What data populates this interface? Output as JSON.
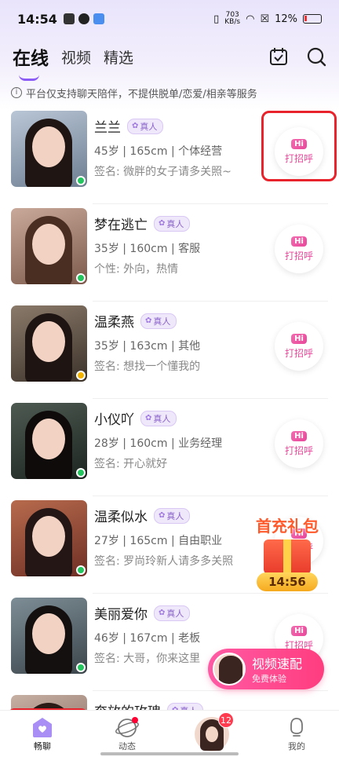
{
  "status_bar": {
    "time": "14:54",
    "net_speed": "703",
    "net_unit": "KB/s",
    "battery": "12%"
  },
  "header": {
    "tabs": [
      {
        "label": "在线",
        "active": true
      },
      {
        "label": "视频",
        "active": false
      },
      {
        "label": "精选",
        "active": false
      }
    ],
    "icons": [
      "calendar-check-icon",
      "search-icon"
    ]
  },
  "notice": "平台仅支持聊天陪伴，不提供脱单/恋爱/相亲等服务",
  "badge_label": "真人",
  "greet": {
    "hi": "Hi",
    "label": "打招呼"
  },
  "users": [
    {
      "name": "兰兰",
      "info": "45岁 | 165cm | 个体经营",
      "sign": "签名: 微胖的女子请多关照~",
      "online_color": "#22c55e"
    },
    {
      "name": "梦在逃亡",
      "info": "35岁 | 160cm | 客服",
      "sign": "个性: 外向，热情",
      "online_color": "#22c55e"
    },
    {
      "name": "温柔燕",
      "info": "35岁 | 163cm | 其他",
      "sign": "签名: 想找一个懂我的",
      "online_color": "#f5b301"
    },
    {
      "name": "小仪吖",
      "info": "28岁 | 160cm | 业务经理",
      "sign": "签名: 开心就好",
      "online_color": "#22c55e"
    },
    {
      "name": "温柔似水",
      "info": "27岁 | 165cm | 自由职业",
      "sign": "签名: 罗尚玲新人请多多关照",
      "online_color": "#22c55e"
    },
    {
      "name": "美丽爱你",
      "info": "46岁 | 167cm | 老板",
      "sign": "签名: 大哥，你来这里",
      "online_color": "#22c55e"
    },
    {
      "name": "奔放的玫瑰",
      "info": "",
      "sign": "",
      "online_color": "#22c55e"
    }
  ],
  "promo": {
    "title": "首充礼包",
    "timer": "14:56"
  },
  "video_match": {
    "title": "视频速配",
    "subtitle": "免费体验"
  },
  "bottom_nav": {
    "items": [
      {
        "label": "畅聊",
        "icon": "chat-home-icon",
        "active": true
      },
      {
        "label": "动态",
        "icon": "moments-icon",
        "active": false
      },
      {
        "label": "",
        "icon": "avatar-icon",
        "count": "12",
        "active": false
      },
      {
        "label": "我的",
        "icon": "profile-icon",
        "active": false
      }
    ]
  },
  "colors": {
    "accent": "#8b5cf6",
    "pink": "#e8489a",
    "highlight": "#e8232c"
  }
}
